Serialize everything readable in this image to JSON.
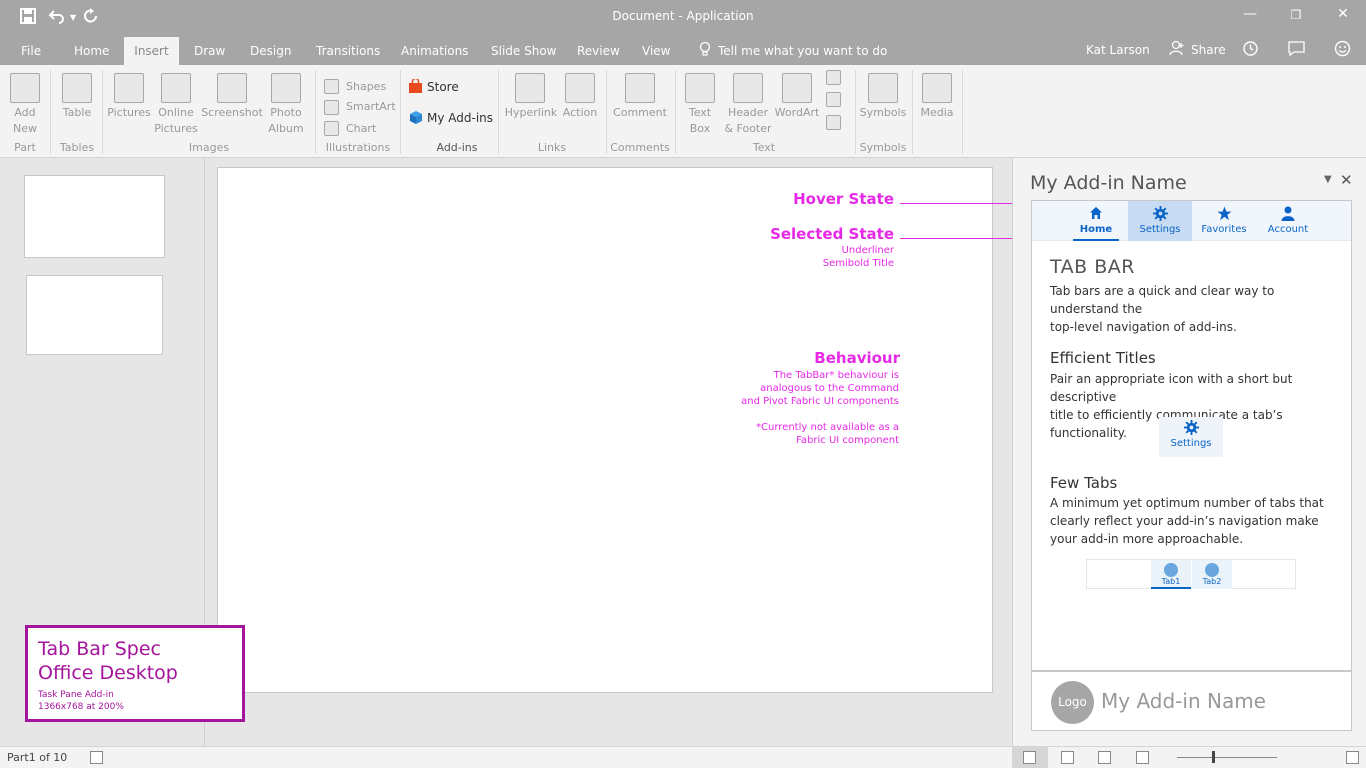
{
  "window": {
    "title": "Document - Application",
    "quick_access": {
      "save": "save-icon",
      "undo": "undo-icon",
      "redo": "redo-icon"
    },
    "controls": {
      "minimize": "—",
      "restore": "❐",
      "close": "✕"
    }
  },
  "menu": {
    "tabs": [
      "File",
      "Home",
      "Insert",
      "Draw",
      "Design",
      "Transitions",
      "Animations",
      "Slide Show",
      "Review",
      "View"
    ],
    "tell_me": "Tell me what you want to do",
    "user": "Kat Larson",
    "share": "Share"
  },
  "ribbon": {
    "add_new": [
      "Add",
      "New"
    ],
    "table": "Table",
    "pictures": "Pictures",
    "online_pictures": [
      "Online",
      "Pictures"
    ],
    "screenshot": "Screenshot",
    "photo_album": [
      "Photo",
      "Album"
    ],
    "shapes": "Shapes",
    "smartart": "SmartArt",
    "chart": "Chart",
    "store": "Store",
    "my_addins": "My Add-ins",
    "hyperlink": "Hyperlink",
    "action": "Action",
    "comment": "Comment",
    "text_box": [
      "Text",
      "Box"
    ],
    "header_footer": [
      "Header",
      "& Footer"
    ],
    "wordart": "WordArt",
    "symbols": "Symbols",
    "media": "Media",
    "groups": {
      "part": "Part",
      "tables": "Tables",
      "images": "Images",
      "illustrations": "Illustrations",
      "addins": "Add-ins",
      "links": "Links",
      "comments": "Comments",
      "text": "Text",
      "symbols": "Symbols"
    }
  },
  "annotations": {
    "hover_title": "Hover State",
    "selected_title": "Selected State",
    "selected_line1": "Underliner",
    "selected_line2": "Semibold Title",
    "behaviour_title": "Behaviour",
    "behaviour_lines": [
      "The TabBar* behaviour is",
      "analogous to the Command",
      "and Pivot Fabric UI components",
      "",
      "*Currently not available as a",
      "Fabric UI component"
    ]
  },
  "spec": {
    "title1": "Tab Bar Spec",
    "title2": "Office Desktop",
    "sub1": "Task Pane Add-in",
    "sub2": "1366x768 at 200%"
  },
  "taskpane": {
    "title": "My Add-in Name",
    "tabs": [
      {
        "label": "Home",
        "icon": "home-icon"
      },
      {
        "label": "Settings",
        "icon": "gear-icon"
      },
      {
        "label": "Favorites",
        "icon": "star-icon"
      },
      {
        "label": "Account",
        "icon": "person-icon"
      }
    ],
    "heading": "TAB BAR",
    "intro_lines": [
      "Tab bars are a quick and clear way to understand the",
      "top-level navigation of add-ins."
    ],
    "section1_title": "Efficient Titles",
    "section1_lines": [
      "Pair an appropriate icon with a short but descriptive",
      "title to efficiently communicate a tab’s functionality."
    ],
    "sample_label": "Settings",
    "section2_title": "Few Tabs",
    "section2_lines": [
      "A minimum yet optimum number of tabs that",
      "clearly reflect your add-in’s navigation make",
      "your add-in more approachable."
    ],
    "mini_tabs": [
      "Tab1",
      "Tab2"
    ],
    "footer_logo": "Logo",
    "footer_name": "My Add-in Name"
  },
  "status": {
    "text": "Part1 of 10"
  },
  "colors": {
    "accent": "#0a64c8",
    "annotation": "#e629e6",
    "spec": "#a4149c",
    "chrome": "#a6a6a6"
  }
}
